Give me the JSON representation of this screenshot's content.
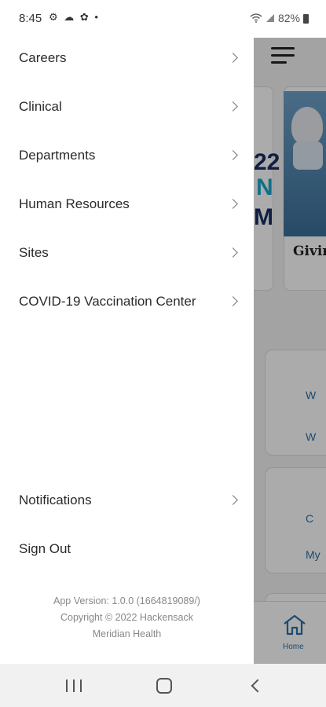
{
  "status_bar": {
    "time": "8:45",
    "left_icons": "⚙ ☁ ✿ •",
    "battery": "82%"
  },
  "drawer": {
    "menu_items": [
      {
        "label": "Careers"
      },
      {
        "label": "Clinical"
      },
      {
        "label": "Departments"
      },
      {
        "label": "Human Resources"
      },
      {
        "label": "Sites"
      },
      {
        "label": "COVID-19 Vaccination Center"
      }
    ],
    "bottom_items": [
      {
        "label": "Notifications"
      },
      {
        "label": "Sign Out"
      }
    ],
    "footer": {
      "version": "App Version: 1.0.0 (1664819089/)",
      "copyright_line1": "Copyright © 2022 Hackensack",
      "copyright_line2": "Meridian Health"
    }
  },
  "background_app": {
    "promo_text_1": "22",
    "promo_text_2": "N",
    "promo_text_3": "M",
    "promo_caption": "Givin",
    "tile_texts": [
      "W",
      "W",
      "C",
      "My"
    ],
    "bottom_nav_home": "Home"
  },
  "colors": {
    "accent": "#2b6fa8",
    "promo_navy": "#1a2d66",
    "promo_cyan": "#19a7c9"
  }
}
